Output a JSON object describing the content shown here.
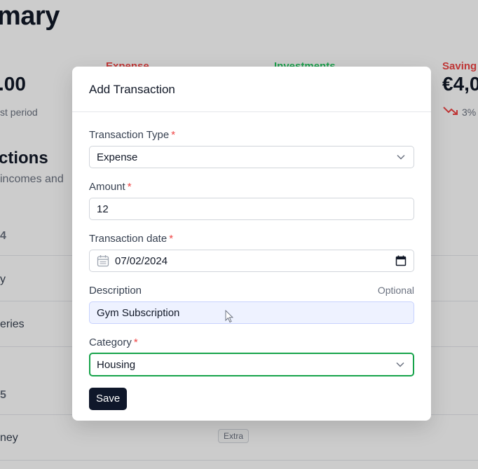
{
  "background": {
    "page_title": "mary",
    "stats": [
      {
        "label": "Expense",
        "value": ".00",
        "sub": "st period"
      },
      {
        "label": "Investments"
      },
      {
        "label": "Saving",
        "value": "€4,0",
        "trend_pct": "3%"
      }
    ],
    "section_title": "ctions",
    "section_subtitle": "incomes and",
    "rows": [
      {
        "text": "4",
        "type": "head"
      },
      {
        "text": "y",
        "type": "row"
      },
      {
        "text": "eries",
        "type": "row"
      },
      {
        "text": "5",
        "type": "head"
      },
      {
        "text": "ney",
        "type": "row",
        "badge": "Extra"
      }
    ],
    "colors": {
      "expense": "#ef4444",
      "investments": "#22c55e",
      "saving": "#ef4444"
    }
  },
  "modal": {
    "title": "Add Transaction",
    "fields": {
      "type": {
        "label": "Transaction Type",
        "required": "*",
        "value": "Expense",
        "icon": "chevron-down-icon"
      },
      "amount": {
        "label": "Amount",
        "required": "*",
        "value": "12"
      },
      "date": {
        "label": "Transaction date",
        "required": "*",
        "value": "07/02/2024",
        "icon": "calendar-icon"
      },
      "description": {
        "label": "Description",
        "optional": "Optional",
        "value": "Gym Subscription"
      },
      "category": {
        "label": "Category",
        "required": "*",
        "value": "Housing",
        "icon": "chevron-down-icon"
      }
    },
    "save_label": "Save",
    "colors": {
      "required": "#ef4444",
      "focus": "#16a34a",
      "button": "#0f172a"
    }
  }
}
